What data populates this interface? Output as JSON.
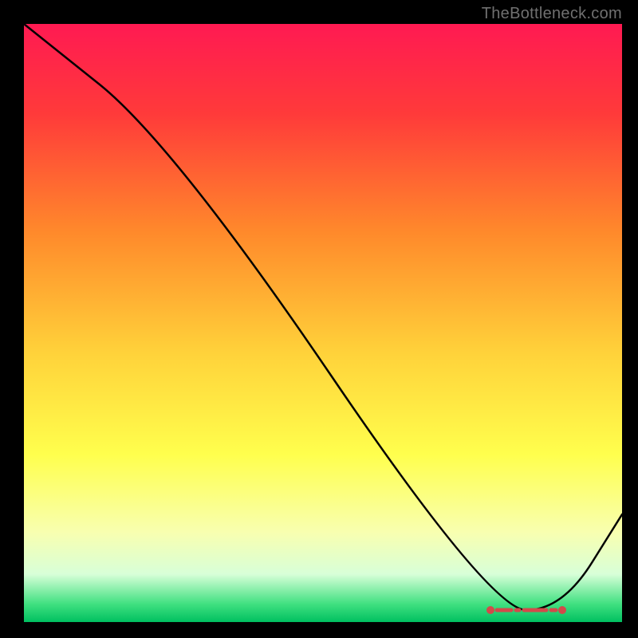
{
  "attribution": "TheBottleneck.com",
  "chart_data": {
    "type": "line",
    "title": "",
    "xlabel": "",
    "ylabel": "",
    "xlim": [
      0,
      100
    ],
    "ylim": [
      0,
      100
    ],
    "series": [
      {
        "name": "curve",
        "x": [
          0,
          25,
          78,
          90,
          100
        ],
        "y": [
          100,
          80,
          2,
          2,
          18
        ]
      }
    ],
    "optimal_band": {
      "x_start": 78,
      "x_end": 90,
      "y": 2
    },
    "gradient_stops": [
      {
        "offset": 0.0,
        "color": "#ff1a52"
      },
      {
        "offset": 0.15,
        "color": "#ff3a3a"
      },
      {
        "offset": 0.35,
        "color": "#ff8a2b"
      },
      {
        "offset": 0.55,
        "color": "#ffd23a"
      },
      {
        "offset": 0.72,
        "color": "#ffff4d"
      },
      {
        "offset": 0.85,
        "color": "#f8ffb0"
      },
      {
        "offset": 0.92,
        "color": "#d8ffd8"
      },
      {
        "offset": 0.97,
        "color": "#40e080"
      },
      {
        "offset": 1.0,
        "color": "#00c060"
      }
    ]
  }
}
